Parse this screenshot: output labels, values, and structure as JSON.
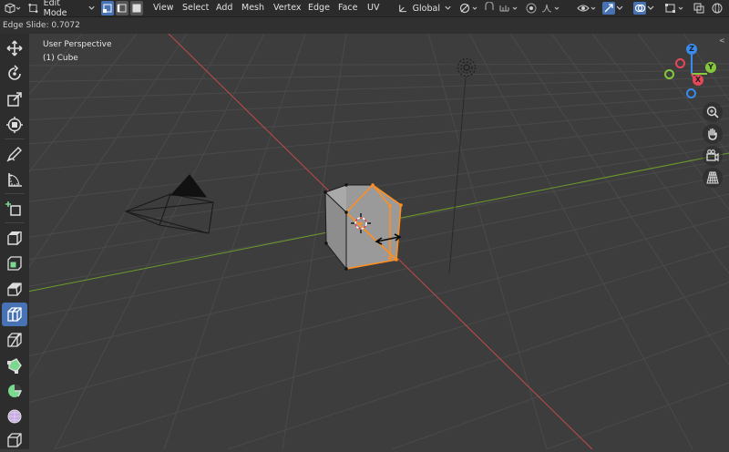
{
  "header": {
    "mode_label": "Edit Mode",
    "menus": [
      "View",
      "Select",
      "Add",
      "Mesh",
      "Vertex",
      "Edge",
      "Face",
      "UV"
    ],
    "transform_orientation": "Global",
    "selection_mode": "edge",
    "colors": {
      "header_bg": "#2b2b2b",
      "active_accent": "#4772b3"
    }
  },
  "status": {
    "operator_text": "Edge Slide: 0.7072"
  },
  "viewport": {
    "perspective_label": "User Perspective",
    "object_label": "(1) Cube",
    "colors": {
      "background": "#3d3d3d",
      "grid": "#4a4a4a",
      "x_axis": "#c44a4a",
      "y_axis": "#6d9b2a",
      "selection": "#ff8f1f",
      "cube_face": "#9a9a9a"
    }
  },
  "gizmo": {
    "x_label": "X",
    "y_label": "Y",
    "z_label": "Z",
    "colors": {
      "x": "#e8475a",
      "y": "#85c93a",
      "z": "#3a8bf0"
    }
  },
  "nav_buttons": [
    "zoom-icon",
    "hand-pan-icon",
    "camera-view-icon",
    "grid-perspective-icon"
  ],
  "toolbar": {
    "tools": [
      "select-box",
      "cursor",
      "move",
      "rotate",
      "scale",
      "transform",
      "annotate",
      "measure",
      "add-cube",
      "extrude-region",
      "inset-faces",
      "bevel",
      "loop-cut",
      "knife",
      "poly-build",
      "spin",
      "smooth"
    ],
    "active_tool": "loop-cut"
  }
}
